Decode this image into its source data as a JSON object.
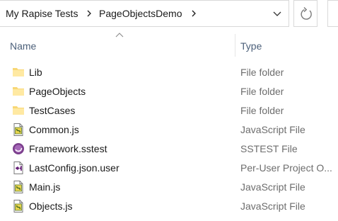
{
  "address_bar": {
    "breadcrumbs": [
      "My Rapise Tests",
      "PageObjectsDemo"
    ]
  },
  "columns": {
    "name": "Name",
    "type": "Type"
  },
  "files": [
    {
      "name": "Lib",
      "type": "File folder",
      "icon": "folder-icon"
    },
    {
      "name": "PageObjects",
      "type": "File folder",
      "icon": "folder-icon"
    },
    {
      "name": "TestCases",
      "type": "File folder",
      "icon": "folder-icon"
    },
    {
      "name": "Common.js",
      "type": "JavaScript File",
      "icon": "javascript-file-icon"
    },
    {
      "name": "Framework.sstest",
      "type": "SSTEST File",
      "icon": "sstest-file-icon"
    },
    {
      "name": "LastConfig.json.user",
      "type": "Per-User Project O...",
      "icon": "visual-studio-user-file-icon"
    },
    {
      "name": "Main.js",
      "type": "JavaScript File",
      "icon": "javascript-file-icon"
    },
    {
      "name": "Objects.js",
      "type": "JavaScript File",
      "icon": "javascript-file-icon"
    }
  ],
  "colors": {
    "folder": "#f8d775",
    "header_text": "#4c607a",
    "type_text": "#6d6d6d",
    "border": "#d9d9d9"
  }
}
